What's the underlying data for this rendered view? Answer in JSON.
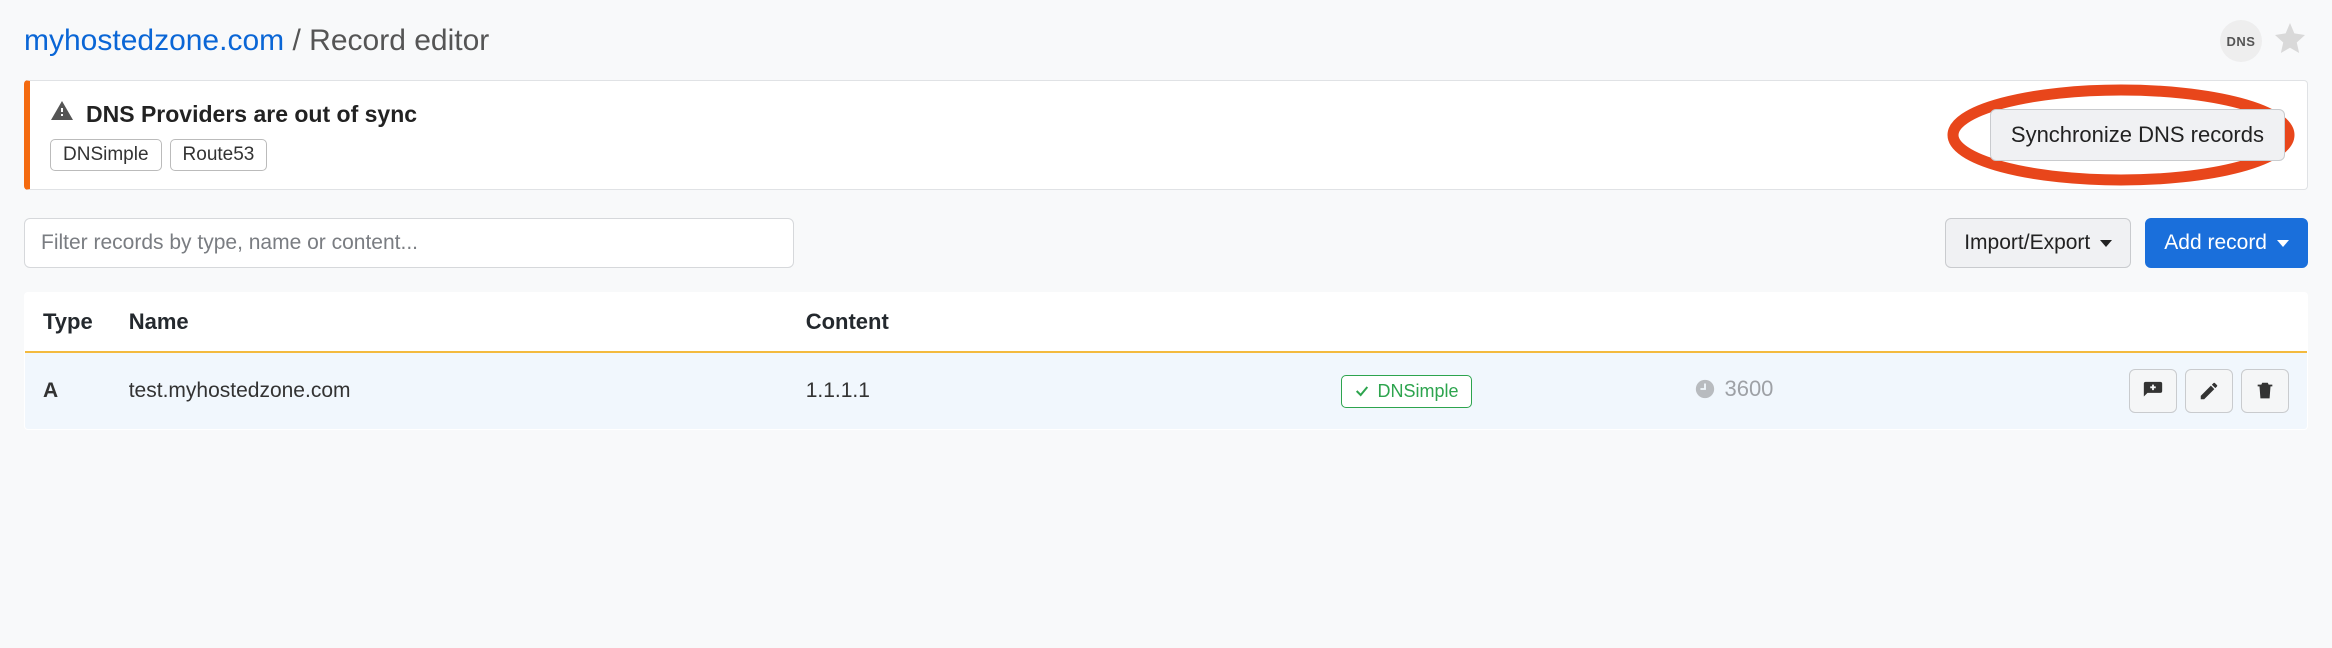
{
  "header": {
    "domain": "myhostedzone.com",
    "separator": "/",
    "page": "Record editor",
    "dns_badge": "DNS"
  },
  "alert": {
    "title": "DNS Providers are out of sync",
    "providers": [
      "DNSimple",
      "Route53"
    ],
    "sync_button": "Synchronize DNS records"
  },
  "toolbar": {
    "filter_placeholder": "Filter records by type, name or content...",
    "import_export": "Import/Export",
    "add_record": "Add record"
  },
  "table": {
    "columns": {
      "type": "Type",
      "name": "Name",
      "content": "Content"
    },
    "rows": [
      {
        "type": "A",
        "name": "test.myhostedzone.com",
        "content": "1.1.1.1",
        "provider": "DNSimple",
        "ttl": "3600"
      }
    ]
  }
}
